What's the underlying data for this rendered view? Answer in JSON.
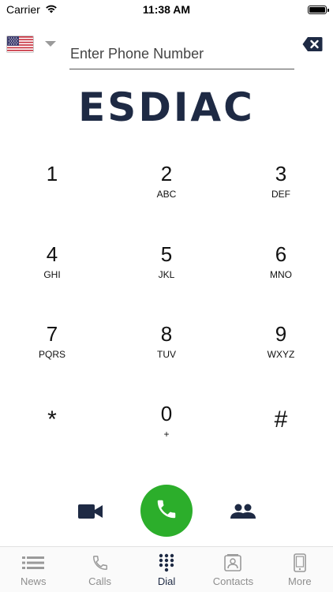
{
  "status_bar": {
    "carrier": "Carrier",
    "time": "11:38 AM"
  },
  "phone_input": {
    "placeholder": "Enter Phone Number",
    "value": ""
  },
  "logo": {
    "text": "ESDIAC"
  },
  "keypad": {
    "keys": [
      {
        "digit": "1",
        "letters": ""
      },
      {
        "digit": "2",
        "letters": "ABC"
      },
      {
        "digit": "3",
        "letters": "DEF"
      },
      {
        "digit": "4",
        "letters": "GHI"
      },
      {
        "digit": "5",
        "letters": "JKL"
      },
      {
        "digit": "6",
        "letters": "MNO"
      },
      {
        "digit": "7",
        "letters": "PQRS"
      },
      {
        "digit": "8",
        "letters": "TUV"
      },
      {
        "digit": "9",
        "letters": "WXYZ"
      },
      {
        "digit": "*",
        "letters": ""
      },
      {
        "digit": "0",
        "letters": "+"
      },
      {
        "digit": "#",
        "letters": ""
      }
    ]
  },
  "tab_bar": {
    "tabs": [
      {
        "label": "News",
        "icon": "news-list-icon"
      },
      {
        "label": "Calls",
        "icon": "phone-handset-icon"
      },
      {
        "label": "Dial",
        "icon": "dialpad-icon",
        "active": true
      },
      {
        "label": "Contacts",
        "icon": "contact-card-icon"
      },
      {
        "label": "More",
        "icon": "mobile-device-icon"
      }
    ]
  },
  "colors": {
    "brand": "#1e2a44",
    "call_green": "#2cae2b",
    "inactive_tab": "#8e8e8e"
  }
}
